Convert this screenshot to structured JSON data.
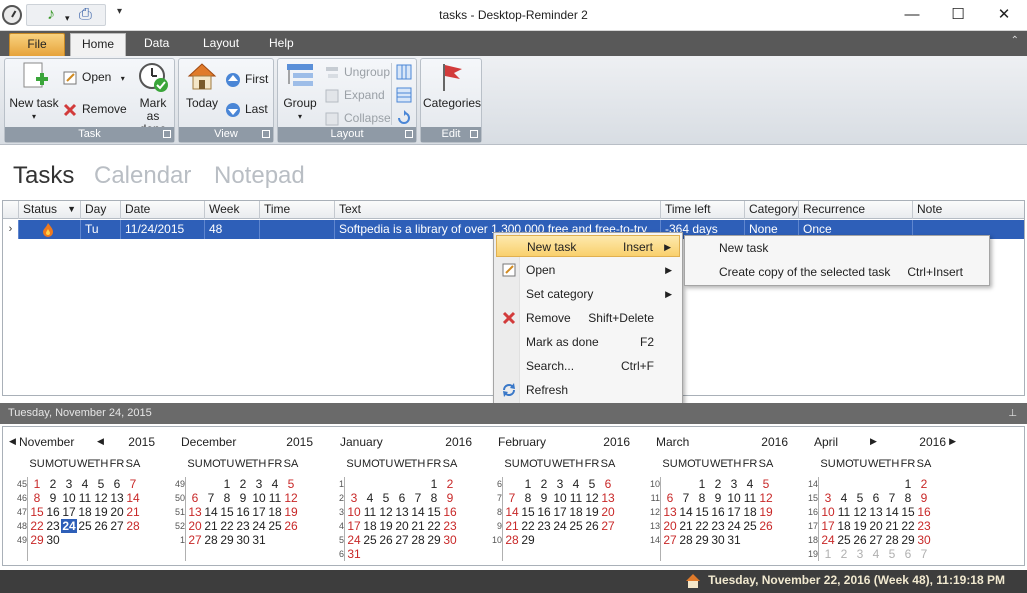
{
  "window": {
    "title": "tasks - Desktop-Reminder 2",
    "minimize": "—",
    "maximize": "☐",
    "close": "✕"
  },
  "ribbon": {
    "tabs": [
      {
        "label": "File"
      },
      {
        "label": "Home"
      },
      {
        "label": "Data"
      },
      {
        "label": "Layout"
      },
      {
        "label": "Help"
      }
    ],
    "groups": {
      "task": {
        "label": "Task",
        "new_task": "New task",
        "open": "Open",
        "remove": "Remove",
        "mark_done_line1": "Mark as",
        "mark_done_line2": "done"
      },
      "view": {
        "label": "View",
        "today": "Today",
        "first": "First",
        "last": "Last"
      },
      "layout": {
        "label": "Layout",
        "group": "Group",
        "ungroup": "Ungroup",
        "expand": "Expand",
        "collapse": "Collapse"
      },
      "edit": {
        "label": "Edit",
        "categories": "Categories"
      }
    }
  },
  "views": {
    "tasks": "Tasks",
    "calendar": "Calendar",
    "notepad": "Notepad"
  },
  "grid": {
    "columns": [
      "Status",
      "Day",
      "Date",
      "Week",
      "Time",
      "Text",
      "Time left",
      "Category",
      "Recurrence",
      "Note"
    ],
    "rows": [
      {
        "day": "Tu",
        "date": "11/24/2015",
        "week": "48",
        "time": "",
        "text": "Softpedia is a library of over 1,300,000 free and free-to-try",
        "time_left": "-364 days",
        "category": "None",
        "recurrence": "Once",
        "note": ""
      }
    ]
  },
  "context_menu": {
    "items": [
      {
        "label": "New task",
        "shortcut": "Insert"
      },
      {
        "label": "Open",
        "shortcut": ""
      },
      {
        "label": "Set category",
        "shortcut": ""
      },
      {
        "label": "Remove",
        "shortcut": "Shift+Delete"
      },
      {
        "label": "Mark as done",
        "shortcut": "F2"
      },
      {
        "label": "Search...",
        "shortcut": "Ctrl+F"
      },
      {
        "label": "Refresh",
        "shortcut": ""
      }
    ],
    "submenu": [
      {
        "label": "New task",
        "shortcut": ""
      },
      {
        "label": "Create copy of the selected task",
        "shortcut": "Ctrl+Insert"
      }
    ]
  },
  "calendar": {
    "title": "Tuesday, November 24, 2015",
    "dow": [
      "SU",
      "MO",
      "TU",
      "WE",
      "TH",
      "FR",
      "SA"
    ],
    "months": [
      {
        "name": "November",
        "year": "2015",
        "weeks": [
          "45",
          "46",
          "47",
          "48",
          "49"
        ]
      },
      {
        "name": "December",
        "year": "2015",
        "weeks": [
          "49",
          "50",
          "51",
          "52",
          "1"
        ]
      },
      {
        "name": "January",
        "year": "2016",
        "weeks": [
          "1",
          "2",
          "3",
          "4",
          "5",
          "6"
        ]
      },
      {
        "name": "February",
        "year": "2016",
        "weeks": [
          "6",
          "7",
          "8",
          "9",
          "10"
        ]
      },
      {
        "name": "March",
        "year": "2016",
        "weeks": [
          "10",
          "11",
          "12",
          "13",
          "14"
        ]
      },
      {
        "name": "April",
        "year": "2016",
        "weeks": [
          "14",
          "15",
          "16",
          "17",
          "18",
          "19"
        ]
      }
    ]
  },
  "status": {
    "datetime": "Tuesday, November 22, 2016 (Week 48), 11:19:18 PM"
  },
  "colors": {
    "selection": "#2e5fb8",
    "weekend": "#c82828",
    "menu_highlight": "#f9d06d"
  }
}
